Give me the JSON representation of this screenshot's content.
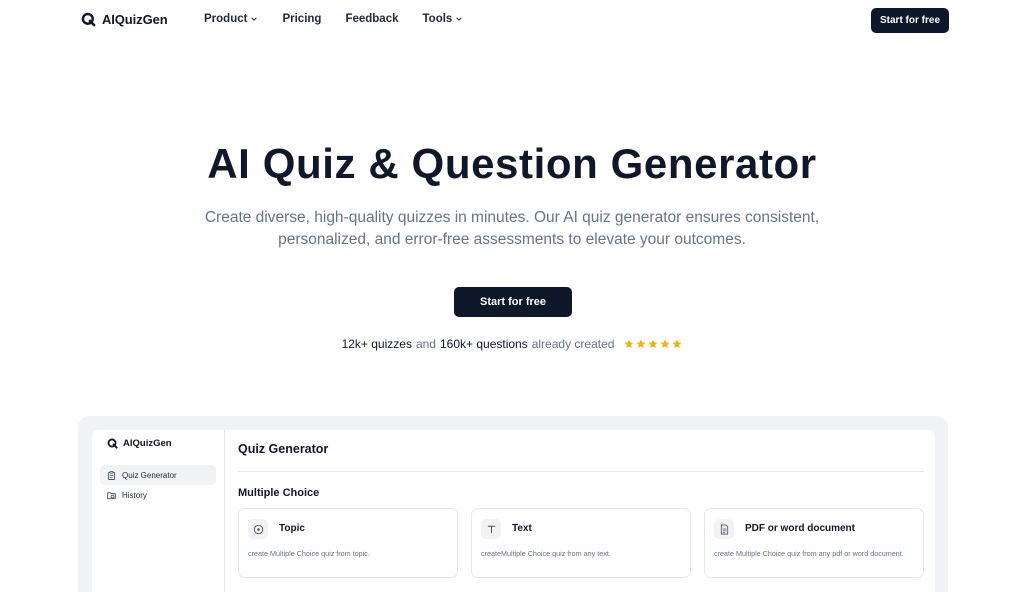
{
  "brand": {
    "name": "AIQuizGen"
  },
  "nav": {
    "links": [
      {
        "label": "Product",
        "has_dropdown": true
      },
      {
        "label": "Pricing",
        "has_dropdown": false
      },
      {
        "label": "Feedback",
        "has_dropdown": false
      },
      {
        "label": "Tools",
        "has_dropdown": true
      }
    ],
    "cta_label": "Start for free"
  },
  "hero": {
    "title": "AI Quiz & Question Generator",
    "subtitle": "Create diverse, high-quality quizzes in minutes. Our AI quiz generator ensures consistent, personalized, and error-free assessments to elevate your outcomes.",
    "cta_label": "Start for free",
    "stats": {
      "quizzes": "12k+ quizzes",
      "and": "and",
      "questions": "160k+ questions",
      "suffix": "already created",
      "rating_stars": 5
    }
  },
  "preview": {
    "sidebar": {
      "brand": "AIQuizGen",
      "items": [
        {
          "label": "Quiz Generator",
          "icon": "clipboard-icon",
          "active": true
        },
        {
          "label": "History",
          "icon": "folder-clock-icon",
          "active": false
        }
      ]
    },
    "main": {
      "title": "Quiz Generator",
      "section_title": "Multiple Choice",
      "cards": [
        {
          "title": "Topic",
          "icon": "target-icon",
          "description": "create Multiple Choice quiz from topic."
        },
        {
          "title": "Text",
          "icon": "text-icon",
          "description": "createMultiple Choice quiz from any text."
        },
        {
          "title": "PDF or word document",
          "icon": "document-icon",
          "description": "create Multiple Choice quiz from any pdf or word document."
        }
      ]
    }
  },
  "colors": {
    "primary": "#0f172a",
    "muted_text": "#64748b",
    "star": "#eab308",
    "preview_bg": "#f1f2f4",
    "border": "#e5e7eb"
  }
}
